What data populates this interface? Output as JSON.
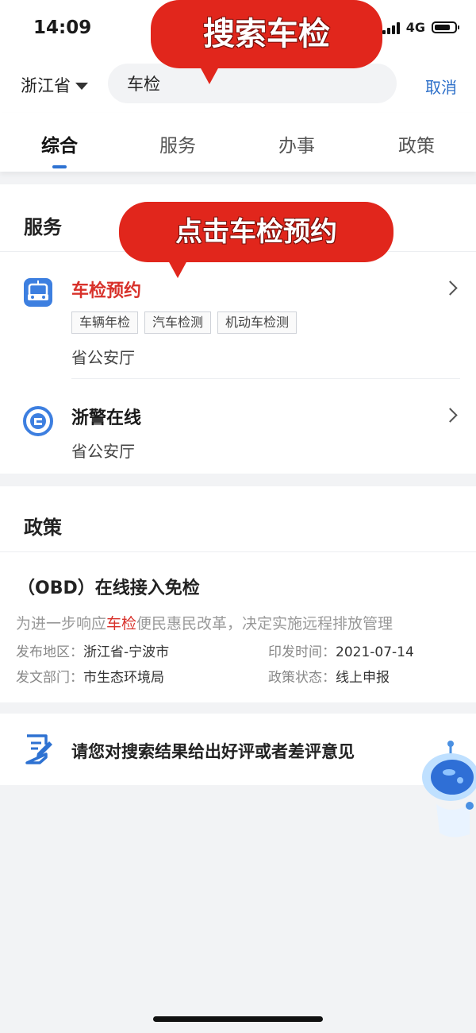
{
  "status_bar": {
    "time": "14:09",
    "network": "4G"
  },
  "search": {
    "region": "浙江省",
    "query": "车检",
    "cancel_label": "取消"
  },
  "tabs": [
    {
      "label": "综合",
      "active": true
    },
    {
      "label": "服务",
      "active": false
    },
    {
      "label": "办事",
      "active": false
    },
    {
      "label": "政策",
      "active": false
    }
  ],
  "annotations": {
    "search_tip": "搜索车检",
    "click_tip": "点击车检预约"
  },
  "services": {
    "title": "服务",
    "items": [
      {
        "name": "车检预约",
        "icon": "car-icon",
        "tags": [
          "车辆年检",
          "汽车检测",
          "机动车检测"
        ],
        "org": "省公安厅"
      },
      {
        "name": "浙警在线",
        "icon": "police-badge-icon",
        "org": "省公安厅"
      }
    ]
  },
  "policy": {
    "title": "政策",
    "item": {
      "title": "（OBD）在线接入免检",
      "desc_before": "为进一步响应",
      "desc_highlight": "车检",
      "desc_after": "便民惠民改革，决定实施远程排放管理",
      "region_label": "发布地区：",
      "region_value": "浙江省-宁波市",
      "date_label": "印发时间：",
      "date_value": "2021-07-14",
      "dept_label": "发文部门：",
      "dept_value": "市生态环境局",
      "status_label": "政策状态：",
      "status_value": "线上申报"
    }
  },
  "feedback": {
    "text": "请您对搜索结果给出好评或者差评意见",
    "icon": "feedback-edit-icon"
  },
  "colors": {
    "accent": "#2e72d2",
    "highlight": "#d8312a",
    "annotation": "#e1261c"
  }
}
